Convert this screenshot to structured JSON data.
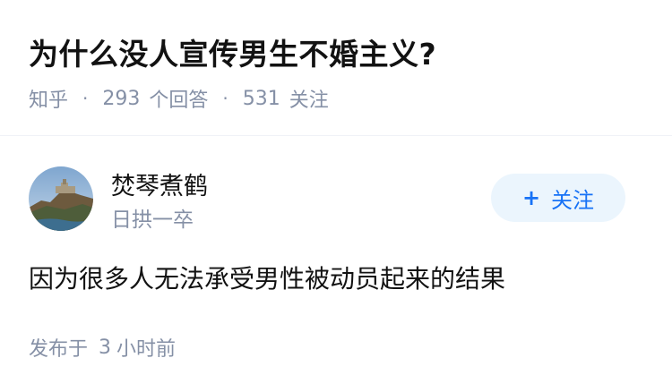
{
  "question": {
    "title": "为什么没人宣传男生不婚主义?",
    "source": "知乎",
    "answer_count": "293",
    "answer_label": "个回答",
    "follower_count": "531",
    "follower_label": "关注",
    "separator": "·"
  },
  "author": {
    "name": "焚琴煮鹤",
    "bio": "日拱一卒",
    "follow_label": "关注",
    "follow_icon": "+"
  },
  "answer": {
    "content": "因为很多人无法承受男性被动员起来的结果",
    "published_prefix": "发布于",
    "published_num": "3",
    "published_suffix": "小时前"
  },
  "colors": {
    "accent": "#1772f6",
    "follow_bg": "#ebf5fd",
    "meta_text": "#8590a6"
  }
}
